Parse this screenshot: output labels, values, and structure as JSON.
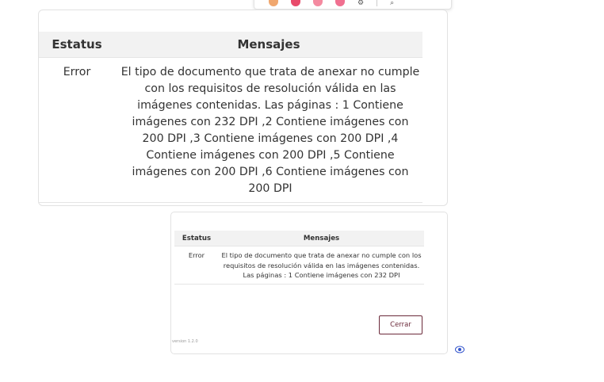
{
  "top_toolbar": {
    "dot_colors": [
      "#f0a76e",
      "#e84a6a",
      "#f48aa0",
      "#f07090"
    ],
    "icons": [
      "settings-icon",
      "search-icon"
    ]
  },
  "dialog_large": {
    "table": {
      "headers": {
        "status": "Estatus",
        "messages": "Mensajes"
      },
      "rows": [
        {
          "status": "Error",
          "message": "El tipo de documento que trata de anexar no cumple con los requisitos de resolución válida en las imágenes contenidas. Las páginas : 1 Contiene imágenes con 232 DPI ,2 Contiene imágenes con 200 DPI ,3 Contiene imágenes con 200 DPI ,4 Contiene imágenes con 200 DPI ,5 Contiene imágenes con 200 DPI ,6 Contiene imágenes con 200 DPI"
        }
      ]
    }
  },
  "dialog_small": {
    "table": {
      "headers": {
        "status": "Estatus",
        "messages": "Mensajes"
      },
      "rows": [
        {
          "status": "Error",
          "message": "El tipo de documento que trata de anexar no cumple con los requisitos de resolución válida en las imágenes contenidas. Las páginas : 1 Contiene imágenes con 232 DPI"
        }
      ]
    },
    "close_label": "Cerrar",
    "version": "version 1.2.0"
  },
  "accent_color": "#6b2a3a"
}
